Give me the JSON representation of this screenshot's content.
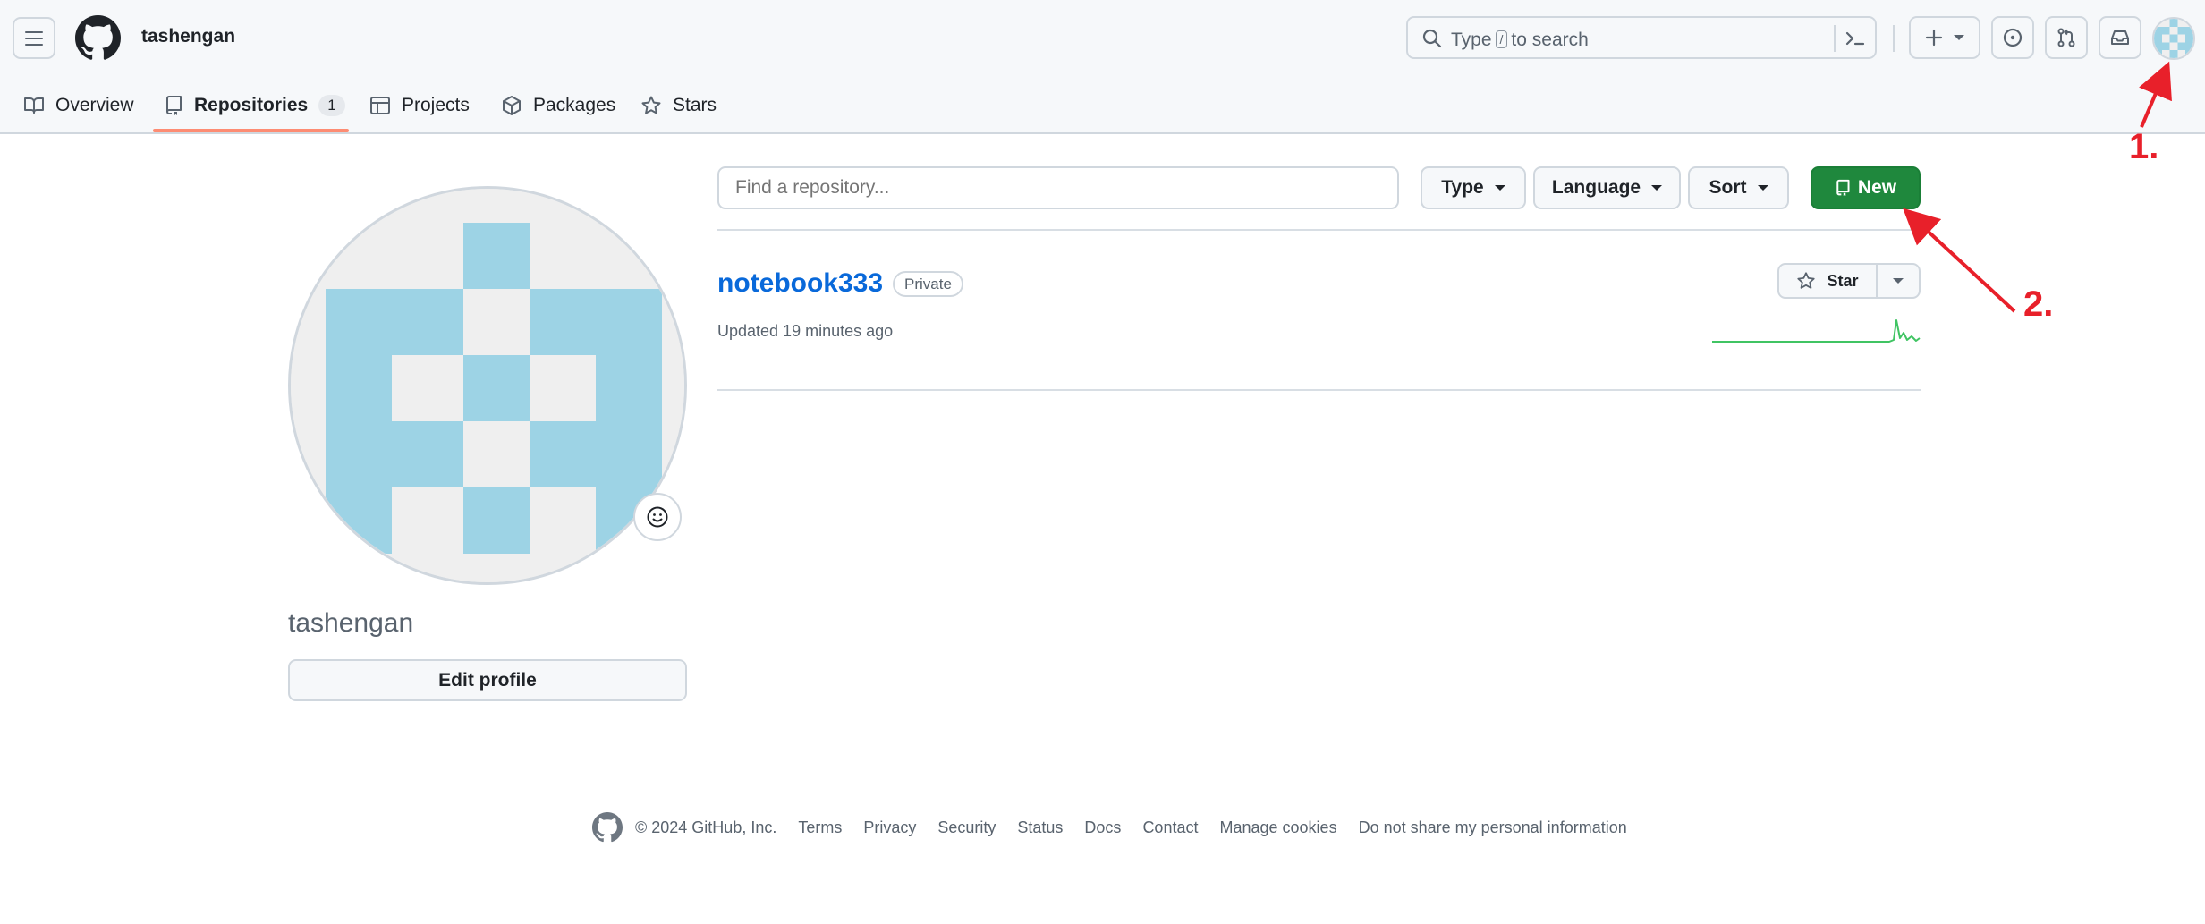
{
  "header": {
    "username": "tashengan",
    "search": {
      "prefix": "Type",
      "key": "/",
      "suffix": "to search"
    }
  },
  "tabs": [
    {
      "label": "Overview"
    },
    {
      "label": "Repositories",
      "count": "1"
    },
    {
      "label": "Projects"
    },
    {
      "label": "Packages"
    },
    {
      "label": "Stars"
    }
  ],
  "profile": {
    "name": "tashengan",
    "edit_label": "Edit profile"
  },
  "repo_toolbar": {
    "find_placeholder": "Find a repository...",
    "type_label": "Type",
    "language_label": "Language",
    "sort_label": "Sort",
    "new_label": "New"
  },
  "repos": [
    {
      "name": "notebook333",
      "visibility": "Private",
      "updated": "Updated 19 minutes ago",
      "star_label": "Star"
    }
  ],
  "annotations": {
    "step1": "1.",
    "step2": "2."
  },
  "footer": {
    "copyright": "© 2024 GitHub, Inc.",
    "links": [
      "Terms",
      "Privacy",
      "Security",
      "Status",
      "Docs",
      "Contact",
      "Manage cookies",
      "Do not share my personal information"
    ]
  },
  "colors": {
    "accent_green": "#1f883d",
    "link_blue": "#0969da",
    "tab_underline": "#fd8c73",
    "identicon": "#9dd3e5",
    "annotation_red": "#e8202a"
  }
}
